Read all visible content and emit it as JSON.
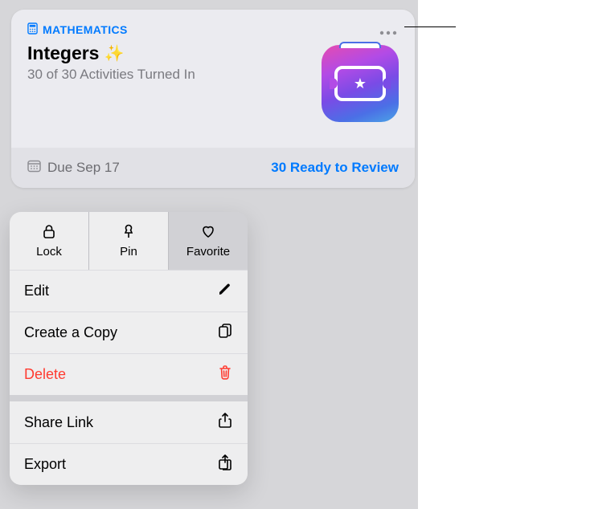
{
  "card": {
    "subject": "MATHEMATICS",
    "title": "Integers",
    "sparkles_emoji": "✨",
    "subtitle": "30 of 30 Activities Turned In",
    "due_label": "Due Sep 17",
    "ready_label": "30 Ready to Review"
  },
  "menu": {
    "top": {
      "lock": "Lock",
      "pin": "Pin",
      "favorite": "Favorite"
    },
    "items": {
      "edit": "Edit",
      "copy": "Create a Copy",
      "delete": "Delete",
      "share": "Share Link",
      "export": "Export"
    }
  },
  "colors": {
    "accent": "#007aff",
    "danger": "#ff3b30"
  }
}
